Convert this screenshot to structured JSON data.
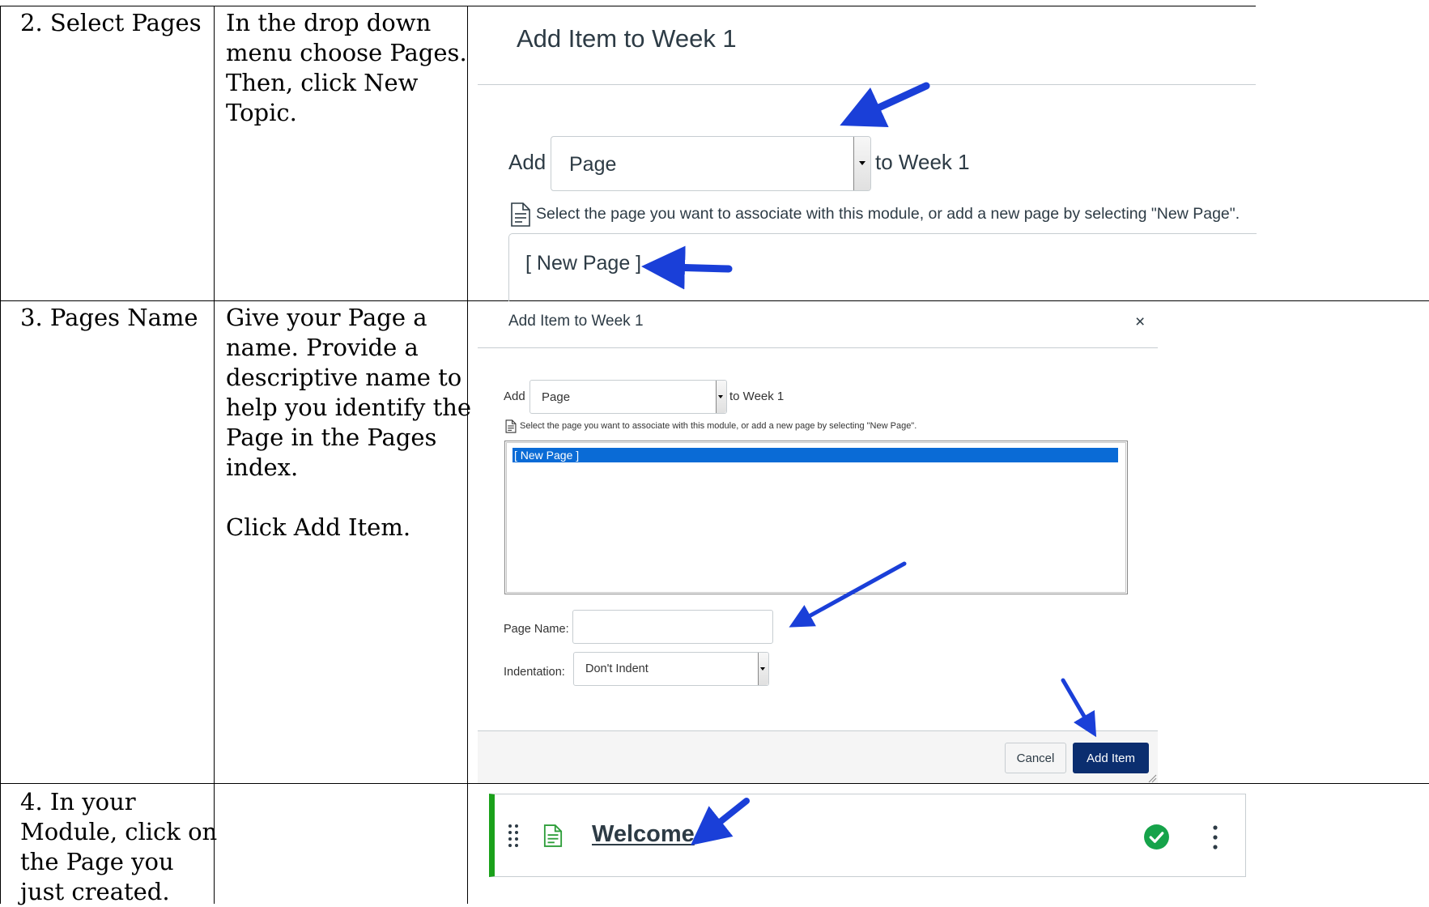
{
  "rows": [
    {
      "step": "2. Select Pages",
      "instructions": "In the drop down\nmenu choose Pages.\nThen, click New\nTopic."
    },
    {
      "step": "3. Pages Name",
      "instructions": "Give your Page a\nname. Provide a\ndescriptive name to\nhelp you identify the\nPage in the Pages\nindex.\n\nClick Add Item."
    },
    {
      "step": "4. In your\nModule, click on\nthe Page you\njust created.",
      "instructions": ""
    }
  ],
  "shot1": {
    "title": "Add Item to Week 1",
    "add_label": "Add",
    "select_value": "Page",
    "to_label": "to Week 1",
    "help_text": "Select the page you want to associate with this module, or add a new page by selecting \"New Page\".",
    "list_item": "[ New Page ]"
  },
  "shot2": {
    "title": "Add Item to Week 1",
    "close": "×",
    "add_label": "Add",
    "select_value": "Page",
    "to_label": "to Week 1",
    "help_text": "Select the page you want to associate with this module, or add a new page by selecting \"New Page\".",
    "list_item": "[ New Page ]",
    "page_name_label": "Page Name:",
    "page_name_value": "",
    "indent_label": "Indentation:",
    "indent_value": "Don't Indent",
    "cancel_label": "Cancel",
    "add_item_label": "Add Item"
  },
  "shot3": {
    "item_title": "Welcome"
  },
  "colors": {
    "arrow": "#1a3fd8",
    "canvas_text": "#2d3b45",
    "selected_bg": "#0a6bd6",
    "primary_button": "#0b2e6f",
    "module_border": "#1aa11a",
    "page_icon": "#2e9e3a",
    "check": "#16a34a"
  }
}
